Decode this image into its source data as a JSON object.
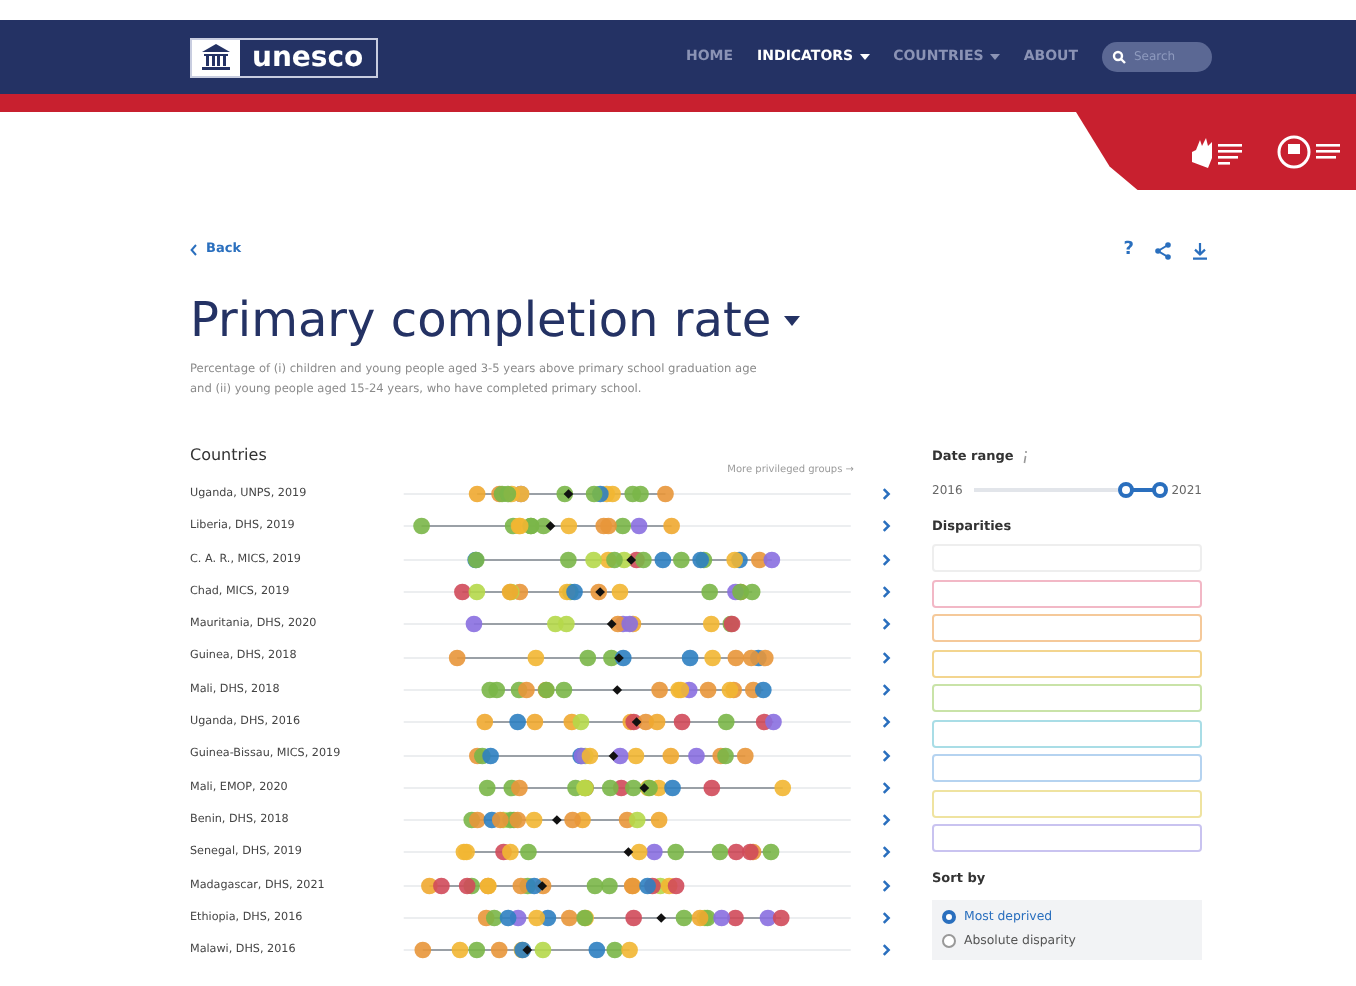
{
  "header": {
    "logo": "unesco",
    "nav": [
      {
        "label": "HOME",
        "selected": false,
        "dropdown": false
      },
      {
        "label": "INDICATORS",
        "selected": true,
        "dropdown": true
      },
      {
        "label": "COUNTRIES",
        "selected": false,
        "dropdown": true
      },
      {
        "label": "ABOUT",
        "selected": false,
        "dropdown": false
      }
    ],
    "search": {
      "placeholder": "Search"
    }
  },
  "back": "Back",
  "help": "?",
  "title": "Primary completion rate",
  "description": "Percentage of (i) children and young people aged 3-5 years above primary school graduation age and (ii) young people aged 15-24 years, who have completed primary school.",
  "chart": {
    "heading": "Countries",
    "axis_hint": "More privileged groups →",
    "rows": [
      {
        "label": "Uganda, UNPS, 2019"
      },
      {
        "label": "Liberia, DHS, 2019"
      },
      {
        "label": "C. A. R., MICS, 2019"
      },
      {
        "label": "Chad, MICS, 2019"
      },
      {
        "label": "Mauritania, DHS, 2020"
      },
      {
        "label": "Guinea, DHS, 2018"
      },
      {
        "label": "Mali, DHS, 2018"
      },
      {
        "label": "Uganda, DHS, 2016"
      },
      {
        "label": "Guinea-Bissau, MICS, 2019"
      },
      {
        "label": "Mali, EMOP, 2020"
      },
      {
        "label": "Benin, DHS, 2018"
      },
      {
        "label": "Senegal, DHS, 2019"
      },
      {
        "label": "Madagascar, DHS, 2021"
      },
      {
        "label": "Ethiopia, DHS, 2016"
      },
      {
        "label": "Malawi, DHS, 2016"
      }
    ]
  },
  "filters": {
    "date_range": {
      "label": "Date range",
      "from": "2016",
      "to": "2021",
      "thumbs": [
        {
          "level": 0.82
        },
        {
          "level": 1
        }
      ]
    },
    "disparities": {
      "label": "Disparities",
      "boxes": [
        {
          "color": "#eeeeee"
        },
        {
          "color": "#f2b8c6"
        },
        {
          "color": "#f5c99a"
        },
        {
          "color": "#f3d58f"
        },
        {
          "color": "#c9e3a8"
        },
        {
          "color": "#a9dde6"
        },
        {
          "color": "#b5d3f0"
        },
        {
          "color": "#efe3a0"
        },
        {
          "color": "#c9c3f0"
        }
      ]
    },
    "sort_by": {
      "label": "Sort by",
      "options": [
        {
          "label": "Most deprived",
          "selected": true
        },
        {
          "label": "Absolute disparity",
          "selected": false
        }
      ]
    }
  }
}
